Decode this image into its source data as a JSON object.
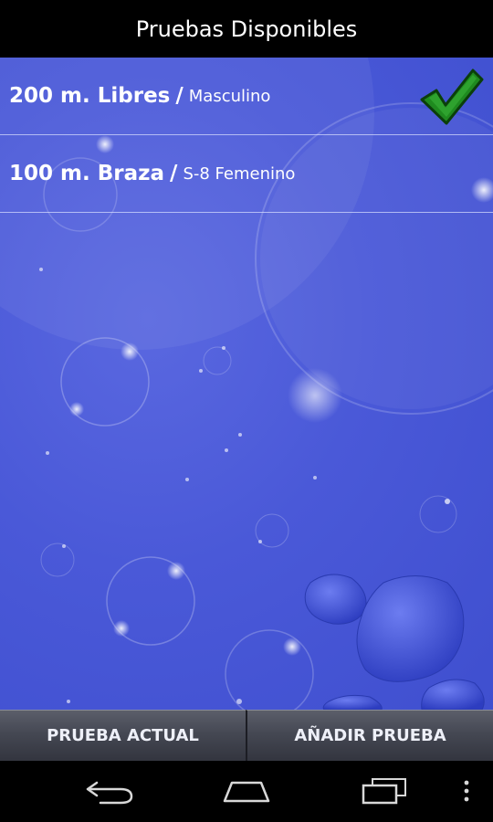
{
  "header": {
    "title": "Pruebas Disponibles"
  },
  "events": [
    {
      "name": "200 m. Libres",
      "separator": "/",
      "category": "Masculino",
      "selected": true
    },
    {
      "name": "100 m. Braza",
      "separator": "/",
      "category": "S-8 Femenino",
      "selected": false
    }
  ],
  "bottom_bar": {
    "current_label": "PRUEBA ACTUAL",
    "add_label": "AÑADIR PRUEBA"
  },
  "icons": {
    "check": "checkmark-icon",
    "back": "back-icon",
    "home": "home-icon",
    "recents": "recent-apps-icon",
    "menu": "overflow-menu-icon"
  },
  "colors": {
    "background": "#4a59d8",
    "check_fill": "#1f8a1f",
    "title_bar": "#000000"
  }
}
